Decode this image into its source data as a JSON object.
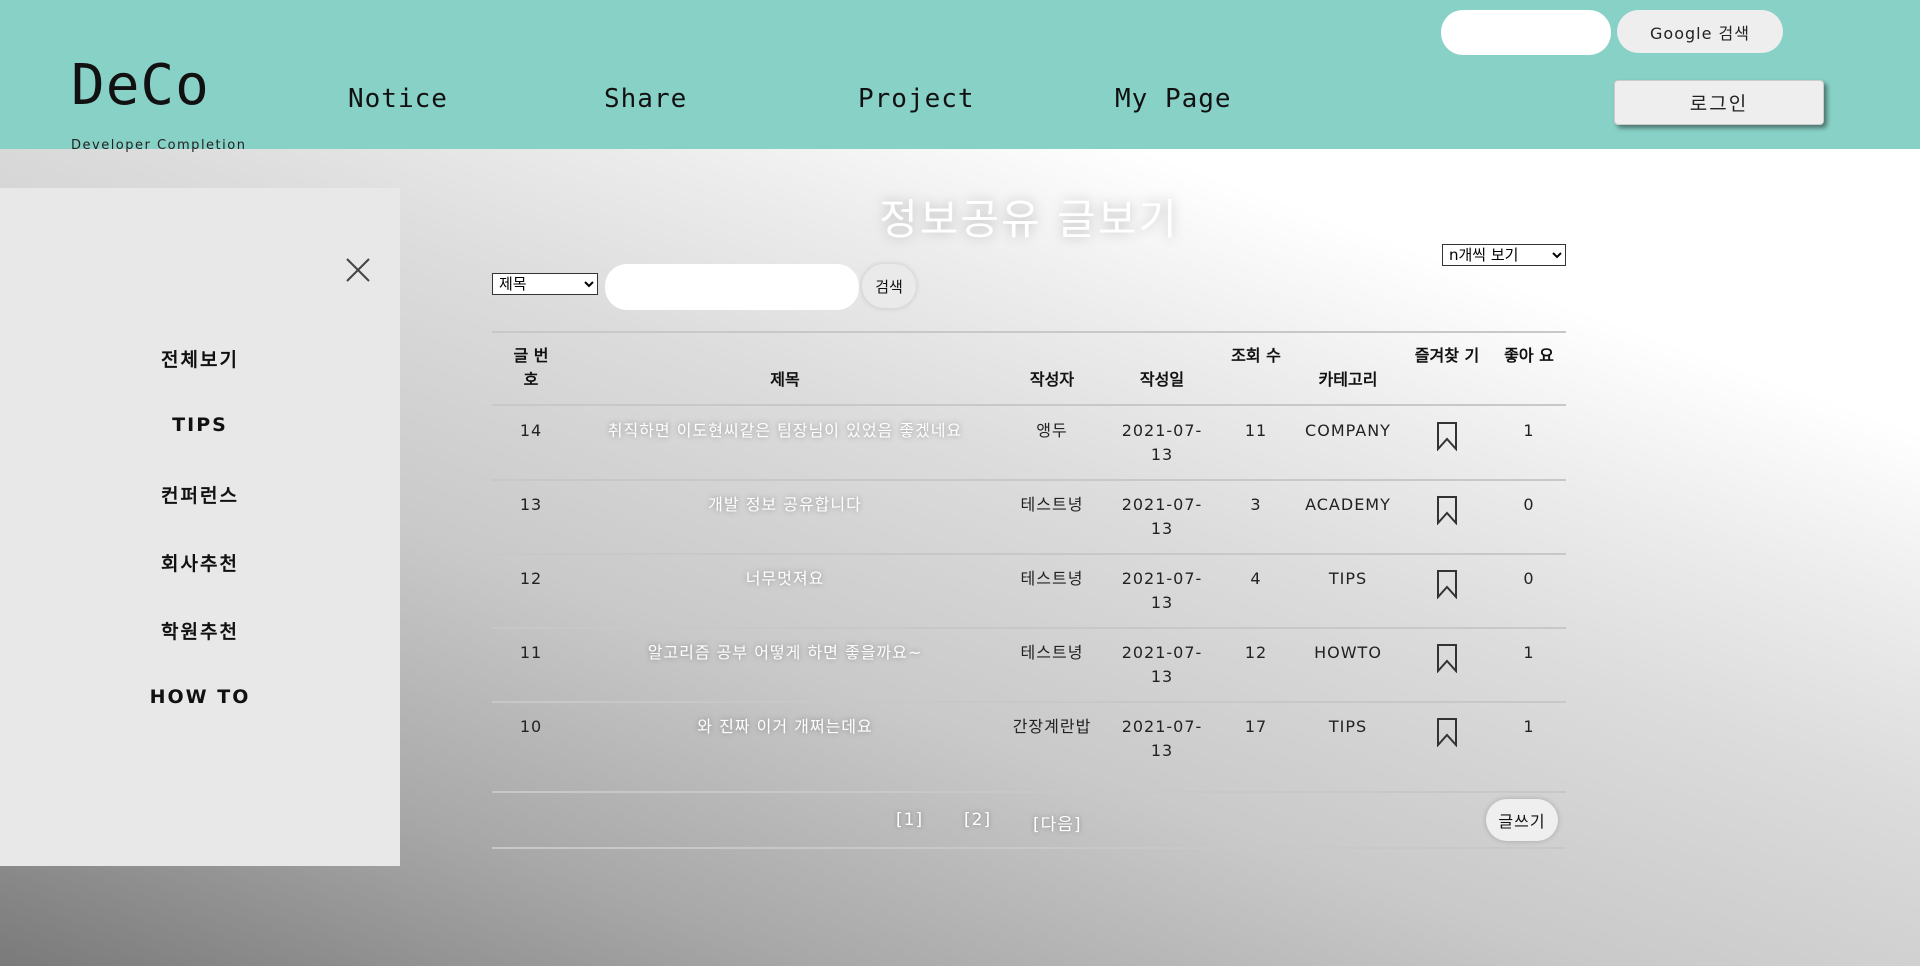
{
  "header": {
    "logo": "DeCo",
    "logo_subtitle": "Developer Completion",
    "nav": [
      {
        "label": "Notice"
      },
      {
        "label": "Share"
      },
      {
        "label": "Project"
      },
      {
        "label": "My Page"
      }
    ],
    "search_value": "",
    "google_search_label": "Google 검색",
    "login_label": "로그인"
  },
  "sidebar": {
    "items": [
      {
        "label": "전체보기"
      },
      {
        "label": "TIPS"
      },
      {
        "label": "컨퍼런스"
      },
      {
        "label": "회사추천"
      },
      {
        "label": "학원추천"
      },
      {
        "label": "HOW TO"
      }
    ]
  },
  "main": {
    "title": "정보공유 글보기",
    "search": {
      "field_selected": "제목",
      "query": "",
      "button_label": "검색"
    },
    "page_size_selected": "n개씩 보기",
    "columns": [
      "글 번 호",
      "제목",
      "작성자",
      "작성일",
      "조회 수",
      "카테고리",
      "즐겨찾 기",
      "좋아 요"
    ],
    "rows": [
      {
        "no": "14",
        "title": "취직하면 이도현씨같은 팀장님이 있었음 좋겠네요",
        "author": "앵두",
        "date": "2021-07-13",
        "views": "11",
        "category": "COMPANY",
        "likes": "1"
      },
      {
        "no": "13",
        "title": "개발 정보 공유합니다",
        "author": "테스트녕",
        "date": "2021-07-13",
        "views": "3",
        "category": "ACADEMY",
        "likes": "0"
      },
      {
        "no": "12",
        "title": "너무멋져요",
        "author": "테스트녕",
        "date": "2021-07-13",
        "views": "4",
        "category": "TIPS",
        "likes": "0"
      },
      {
        "no": "11",
        "title": "알고리즘 공부 어떻게 하면 좋을까요~",
        "author": "테스트녕",
        "date": "2021-07-13",
        "views": "12",
        "category": "HOWTO",
        "likes": "1"
      },
      {
        "no": "10",
        "title": "와 진짜 이거 개쩌는데요",
        "author": "간장계란밥",
        "date": "2021-07-13",
        "views": "17",
        "category": "TIPS",
        "likes": "1"
      }
    ],
    "pagination": [
      "[1]",
      "[2]",
      "[다음]"
    ],
    "write_label": "글쓰기"
  }
}
